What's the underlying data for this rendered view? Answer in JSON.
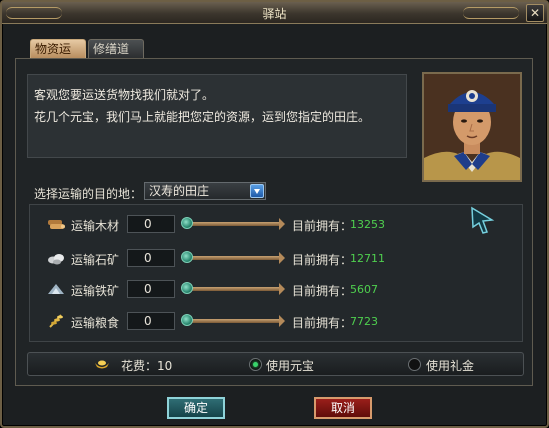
{
  "window": {
    "title": "驿站",
    "close_label": "✕"
  },
  "tabs": [
    {
      "label": "物资运输",
      "active": true
    },
    {
      "label": "修缮道路",
      "active": false
    }
  ],
  "info": {
    "line1": "客观您要运送货物找我们就对了。",
    "line2": "花几个元宝，我们马上就能把您定的资源，运到您指定的田庄。"
  },
  "destination": {
    "label": "选择运输的目的地：",
    "value": "汉寿的田庄"
  },
  "resources": [
    {
      "icon": "wood-icon",
      "label": "运输木材",
      "qty": "0",
      "owned_label": "目前拥有：",
      "owned": "13253"
    },
    {
      "icon": "stone-icon",
      "label": "运输石矿",
      "qty": "0",
      "owned_label": "目前拥有：",
      "owned": "12711"
    },
    {
      "icon": "iron-icon",
      "label": "运输铁矿",
      "qty": "0",
      "owned_label": "目前拥有：",
      "owned": "5607"
    },
    {
      "icon": "grain-icon",
      "label": "运输粮食",
      "qty": "0",
      "owned_label": "目前拥有：",
      "owned": "7723"
    }
  ],
  "cost": {
    "text": "花费：10",
    "option_yuanbao": "使用元宝",
    "option_lijin": "使用礼金",
    "selected": "yuanbao"
  },
  "buttons": {
    "ok": "确定",
    "cancel": "取消"
  },
  "colors": {
    "owned_value": "#4fd04f",
    "accent_ok": "#2f6d74",
    "accent_cancel": "#9a1f1a"
  }
}
